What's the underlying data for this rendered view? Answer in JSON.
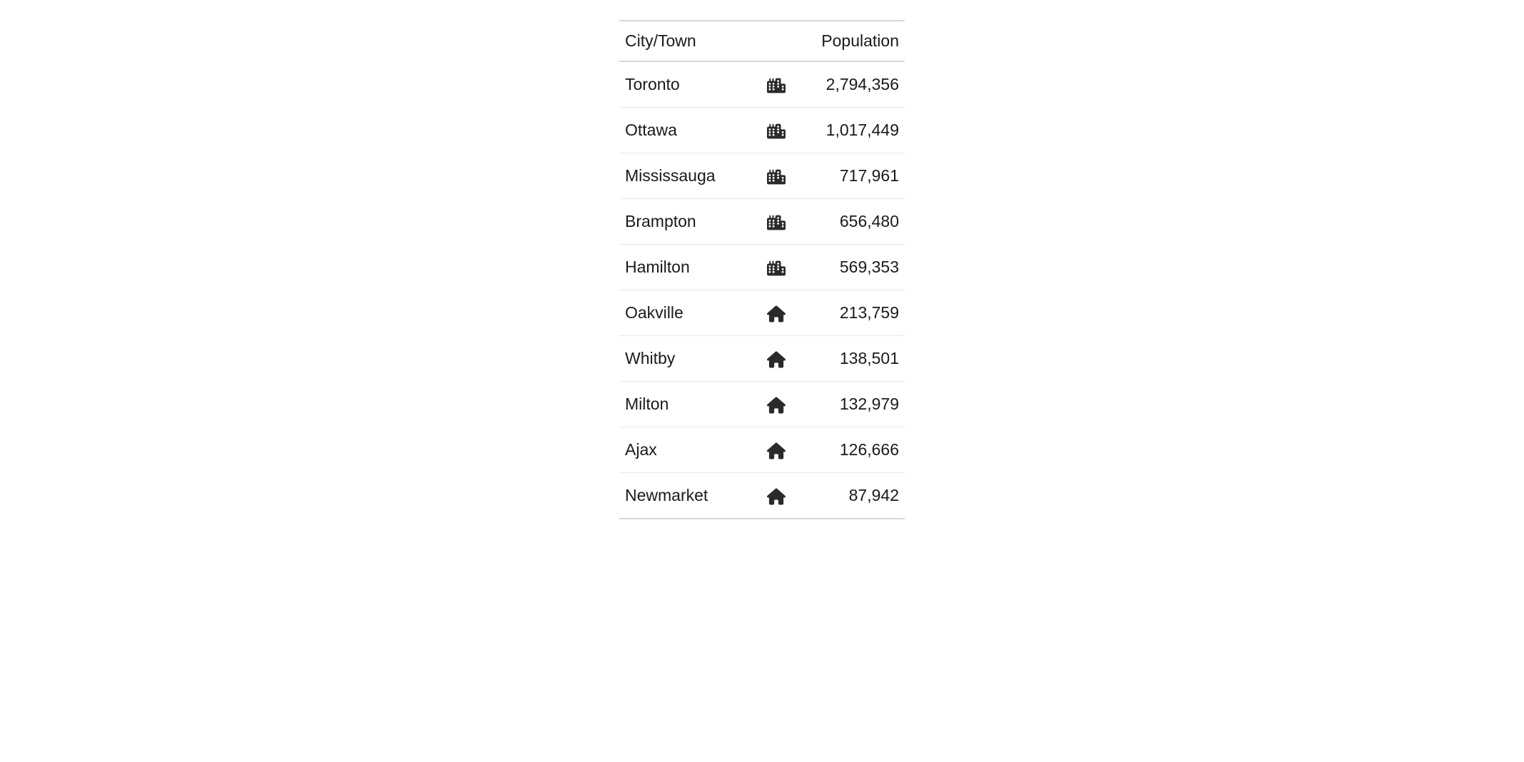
{
  "table": {
    "headers": {
      "city": "City/Town",
      "population": "Population"
    },
    "rows": [
      {
        "city": "Toronto",
        "icon": "city",
        "population": "2,794,356"
      },
      {
        "city": "Ottawa",
        "icon": "city",
        "population": "1,017,449"
      },
      {
        "city": "Mississauga",
        "icon": "city",
        "population": "717,961"
      },
      {
        "city": "Brampton",
        "icon": "city",
        "population": "656,480"
      },
      {
        "city": "Hamilton",
        "icon": "city",
        "population": "569,353"
      },
      {
        "city": "Oakville",
        "icon": "house",
        "population": "213,759"
      },
      {
        "city": "Whitby",
        "icon": "house",
        "population": "138,501"
      },
      {
        "city": "Milton",
        "icon": "house",
        "population": "132,979"
      },
      {
        "city": "Ajax",
        "icon": "house",
        "population": "126,666"
      },
      {
        "city": "Newmarket",
        "icon": "house",
        "population": "87,942"
      }
    ]
  }
}
